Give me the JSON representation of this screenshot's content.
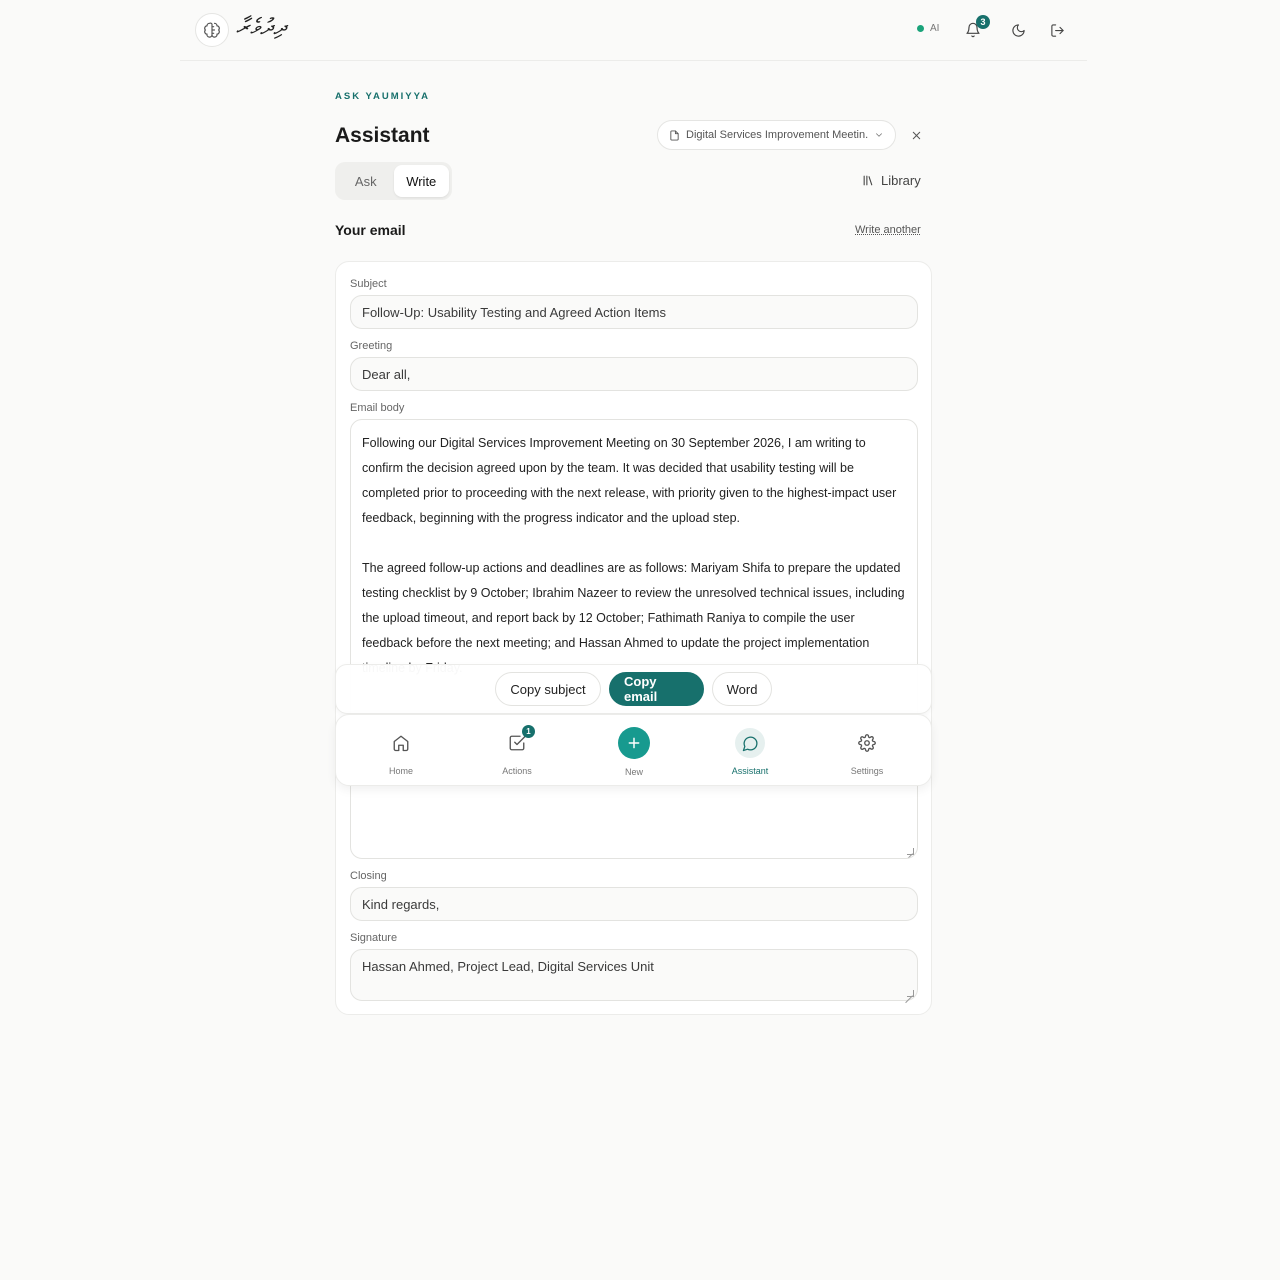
{
  "header": {
    "logo_text": "ދިދުވެރާ",
    "ai_label": "AI",
    "notification_count": "3",
    "colors": {
      "accent": "#17706c",
      "ai_status": "#1aa37a"
    }
  },
  "page": {
    "eyebrow": "ASK YAUMIYYA",
    "title": "Assistant",
    "document_selector": "Digital Services Improvement Meetin...",
    "tabs": [
      {
        "label": "Ask",
        "active": false
      },
      {
        "label": "Write",
        "active": true
      }
    ],
    "library_label": "Library",
    "section_title": "Your email",
    "write_another_label": "Write another"
  },
  "email": {
    "subject_label": "Subject",
    "subject": "Follow-Up: Usability Testing and Agreed Action Items",
    "greeting_label": "Greeting",
    "greeting": "Dear all,",
    "body_label": "Email body",
    "body_paragraphs": [
      "Following our Digital Services Improvement Meeting on 30 September 2026, I am writing to confirm the decision agreed upon by the team. It was decided that usability testing will be completed prior to proceeding with the next release, with priority given to the highest-impact user feedback, beginning with the progress indicator and the upload step.",
      "The agreed follow-up actions and deadlines are as follows: Mariyam Shifa to prepare the updated testing checklist by 9 October; Ibrahim Nazeer to review the unresolved technical issues, including the upload timeout, and report back by 12 October; Fathimath Raniya to compile the user feedback before the next meeting; and Hassan Ahmed to update the project implementation timeline by Friday."
    ],
    "closing_label": "Closing",
    "closing": "Kind regards,",
    "signature_label": "Signature",
    "signature": "Hassan Ahmed, Project Lead, Digital Services Unit"
  },
  "actions": {
    "copy_subject": "Copy subject",
    "copy_email": "Copy email",
    "word": "Word"
  },
  "nav": {
    "items": [
      {
        "label": "Home",
        "icon": "home-icon"
      },
      {
        "label": "Actions",
        "icon": "checkbox-icon",
        "badge": "1"
      },
      {
        "label": "New",
        "icon": "plus-icon"
      },
      {
        "label": "Assistant",
        "icon": "chat-icon",
        "active": true
      },
      {
        "label": "Settings",
        "icon": "gear-icon"
      }
    ]
  }
}
